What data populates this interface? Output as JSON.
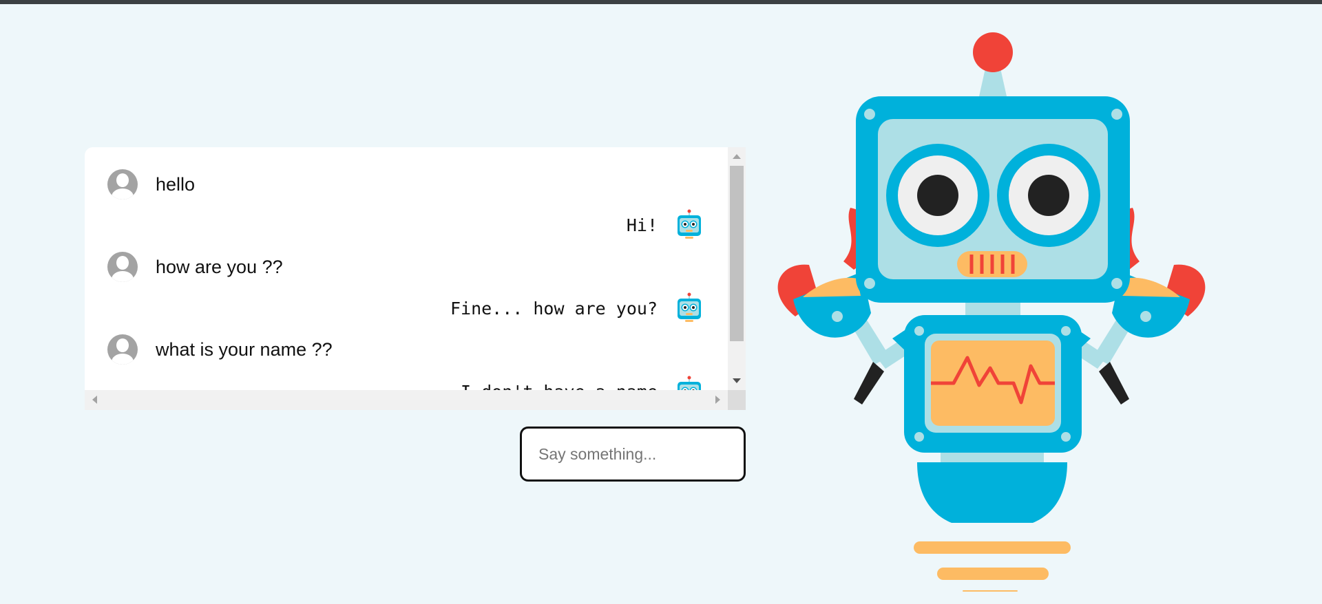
{
  "chat": {
    "messages": [
      {
        "sender": "user",
        "text": "hello"
      },
      {
        "sender": "bot",
        "text": "Hi!"
      },
      {
        "sender": "user",
        "text": "how are you ??"
      },
      {
        "sender": "bot",
        "text": "Fine... how are you?"
      },
      {
        "sender": "user",
        "text": "what is your name ??"
      },
      {
        "sender": "bot",
        "text": "I don't have a name"
      }
    ]
  },
  "input": {
    "placeholder": "Say something...",
    "value": ""
  },
  "colors": {
    "background": "#eef7fa",
    "robot_blue": "#00b1db",
    "robot_light": "#addfe6",
    "robot_red": "#f04338",
    "robot_orange": "#fdbb63"
  },
  "icons": {
    "user_avatar": "user-avatar-icon",
    "bot_avatar": "robot-icon"
  }
}
